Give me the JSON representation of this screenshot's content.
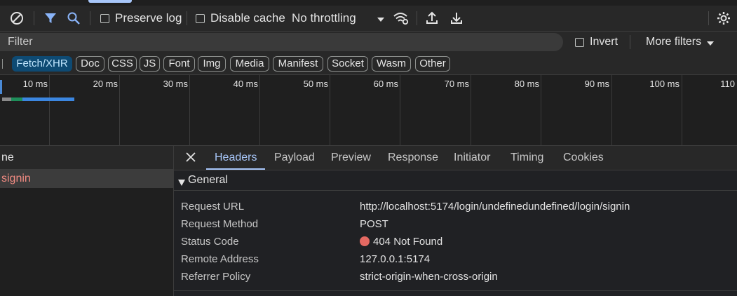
{
  "toolbar": {
    "preserve_log_label": "Preserve log",
    "disable_cache_label": "Disable cache",
    "throttling_value": "No throttling"
  },
  "filter": {
    "placeholder": "Filter",
    "invert_label": "Invert",
    "more_filters_label": "More filters"
  },
  "type_filters": [
    "Fetch/XHR",
    "Doc",
    "CSS",
    "JS",
    "Font",
    "Img",
    "Media",
    "Manifest",
    "Socket",
    "Wasm",
    "Other"
  ],
  "timeline": {
    "ticks": [
      "10 ms",
      "20 ms",
      "30 ms",
      "40 ms",
      "50 ms",
      "60 ms",
      "70 ms",
      "80 ms",
      "90 ms",
      "100 ms",
      "110"
    ]
  },
  "request_list": {
    "column_header": "ne",
    "rows": [
      {
        "name": "signin"
      }
    ]
  },
  "details": {
    "tabs": [
      "Headers",
      "Payload",
      "Preview",
      "Response",
      "Initiator",
      "Timing",
      "Cookies"
    ],
    "active_tab": "Headers",
    "section_title": "General",
    "rows": [
      {
        "key": "Request URL",
        "value": "http://localhost:5174/login/undefinedundefined/login/signin"
      },
      {
        "key": "Request Method",
        "value": "POST"
      },
      {
        "key": "Status Code",
        "value": "404 Not Found"
      },
      {
        "key": "Remote Address",
        "value": "127.0.0.1:5174"
      },
      {
        "key": "Referrer Policy",
        "value": "strict-origin-when-cross-origin"
      }
    ]
  },
  "colors": {
    "accent": "#a8c7fa",
    "active_chip_bg": "#0e4a73",
    "error_dot": "#e46962",
    "selected_row_text": "#f28b82"
  }
}
